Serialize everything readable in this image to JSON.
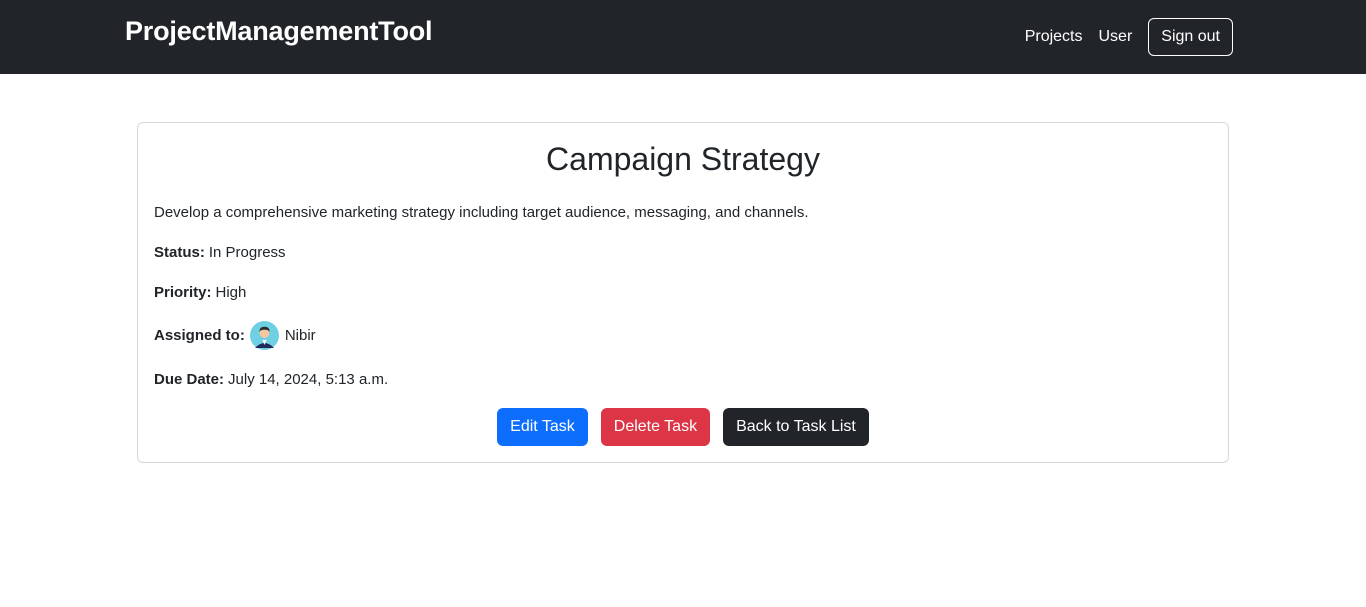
{
  "navbar": {
    "brand": "ProjectManagementTool",
    "links": [
      "Projects",
      "User"
    ],
    "signout_label": "Sign out"
  },
  "task": {
    "title": "Campaign Strategy",
    "description": "Develop a comprehensive marketing strategy including target audience, messaging, and channels.",
    "status_label": "Status:",
    "status": "In Progress",
    "priority_label": "Priority:",
    "priority": "High",
    "assigned_label": "Assigned to:",
    "assignee": "Nibir",
    "due_label": "Due Date:",
    "due_date": "July 14, 2024, 5:13 a.m."
  },
  "actions": {
    "edit_label": "Edit Task",
    "delete_label": "Delete Task",
    "back_label": "Back to Task List"
  },
  "colors": {
    "navbar_bg": "#212529",
    "primary": "#0d6efd",
    "danger": "#dc3545",
    "dark": "#212529"
  }
}
